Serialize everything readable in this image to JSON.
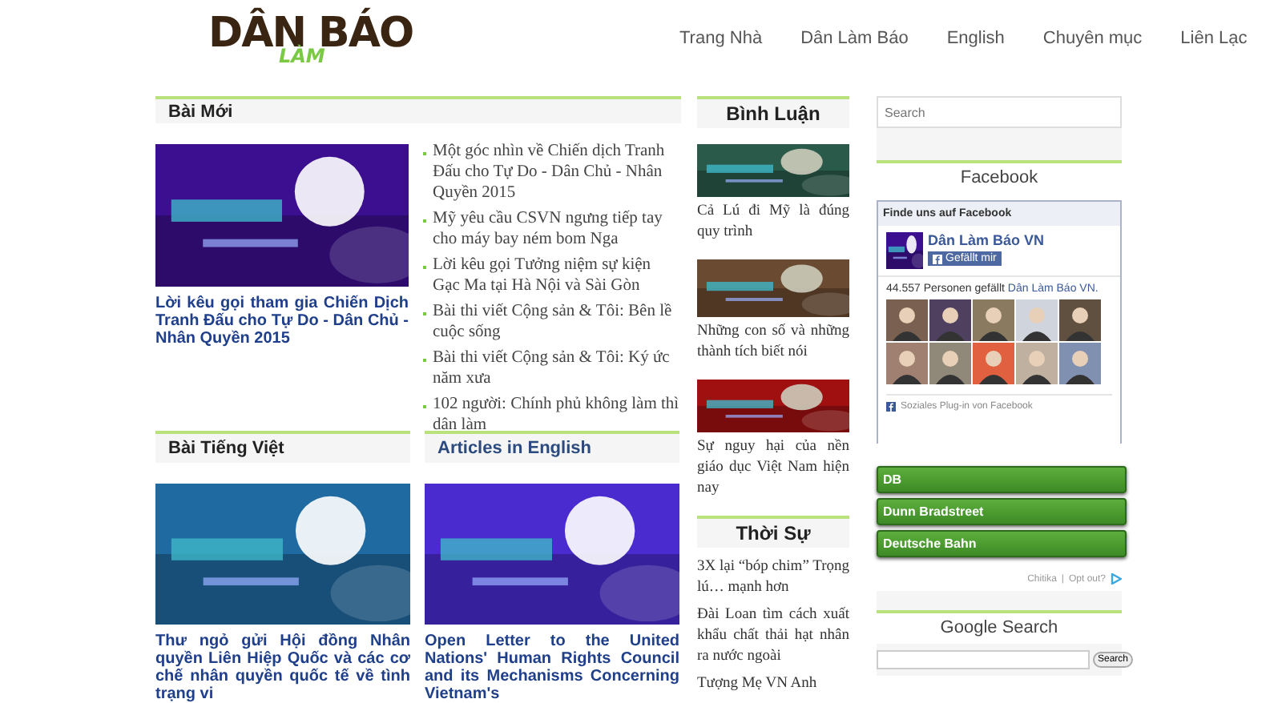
{
  "header": {
    "logo": {
      "main": "DÂN BÁO",
      "accent": "LÀM"
    },
    "nav": [
      {
        "label": "Trang Nhà"
      },
      {
        "label": "Dân Làm Báo"
      },
      {
        "label": "English"
      },
      {
        "label": "Chuyên mục"
      },
      {
        "label": "Liên Lạc"
      }
    ]
  },
  "latest": {
    "title": "Bài Mới",
    "feature": {
      "title": "Lời kêu gọi tham gia Chiến Dịch Tranh Đấu cho Tự Do - Dân Chủ - Nhân Quyền 2015"
    },
    "items": [
      "Một góc nhìn về Chiến dịch Tranh Đấu cho Tự Do - Dân Chủ - Nhân Quyền 2015",
      "Mỹ yêu cầu CSVN ngưng tiếp tay cho máy bay ném bom Nga",
      "Lời kêu gọi Tưởng niệm sự kiện Gạc Ma tại Hà Nội và Sài Gòn",
      "Bài thi viết Cộng sản & Tôi: Bên lề cuộc sống",
      "Bài thi viết Cộng sản & Tôi: Ký ức năm xưa",
      "102 người: Chính phủ không làm thì dân làm"
    ]
  },
  "sections": [
    {
      "title": "Bài Tiếng Việt",
      "feature": {
        "title": "Thư ngỏ gửi Hội đồng Nhân quyền Liên Hiệp Quốc và các cơ chế nhân quyền quốc tế về tình trạng vi"
      }
    },
    {
      "title": "Articles in English",
      "feature": {
        "title": "Open Letter to the United Nations' Human Rights Council and its Mechanisms Concerning Vietnam's"
      }
    }
  ],
  "comments": {
    "title": "Bình Luận",
    "posts": [
      {
        "title": "Cả Lú đi Mỹ là đúng quy trình"
      },
      {
        "title": "Những con số và những thành tích biết nói"
      },
      {
        "title": "Sự nguy hại của nền giáo dục Việt Nam hiện nay"
      }
    ]
  },
  "news": {
    "title": "Thời Sự",
    "items": [
      "3X lại “bóp chim” Trọng lú… mạnh hơn",
      "Đài Loan tìm cách xuất khẩu chất thải hạt nhân ra nước ngoài",
      "Tượng Mẹ VN Anh"
    ]
  },
  "sidebar": {
    "search": {
      "placeholder": "Search"
    },
    "facebook": {
      "title": "Facebook",
      "box_title": "Finde uns auf Facebook",
      "page_name": "Dân Làm Báo VN",
      "like_button": "Gefällt mir",
      "likes_text": "44.557 Personen gefällt",
      "likes_link": "Dân Làm Báo VN.",
      "plugin_note": "Soziales Plug-in von Facebook"
    },
    "ads": [
      "DB",
      "Dunn Bradstreet",
      "Deutsche Bahn"
    ],
    "ad_footer": {
      "brand": "Chitika",
      "separator": "|",
      "opt_out": "Opt out?"
    },
    "google": {
      "title": "Google Search",
      "button": "Search"
    }
  }
}
